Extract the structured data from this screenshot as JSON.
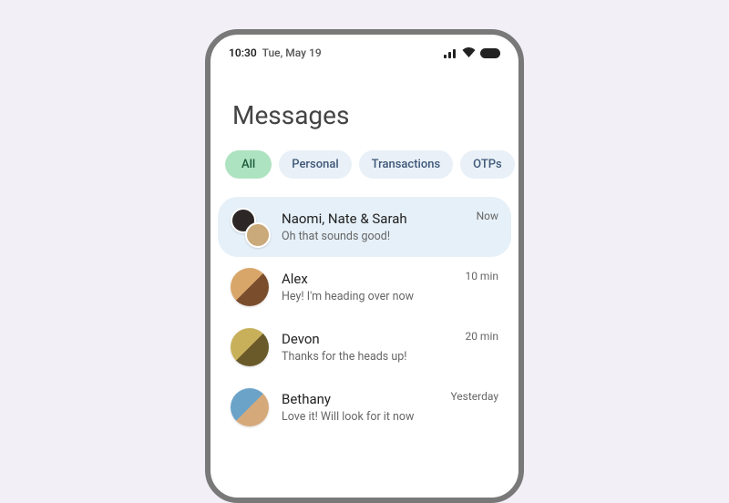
{
  "status": {
    "time": "10:30",
    "date": "Tue, May 19"
  },
  "page": {
    "title": "Messages"
  },
  "tabs": [
    {
      "label": "All",
      "active": true
    },
    {
      "label": "Personal",
      "active": false
    },
    {
      "label": "Transactions",
      "active": false
    },
    {
      "label": "OTPs",
      "active": false
    }
  ],
  "conversations": [
    {
      "name": "Naomi, Nate & Sarah",
      "preview": "Oh that sounds good!",
      "time": "Now",
      "highlight": true,
      "group": true
    },
    {
      "name": "Alex",
      "preview": "Hey! I'm heading over now",
      "time": "10 min",
      "highlight": false,
      "group": false
    },
    {
      "name": "Devon",
      "preview": "Thanks for the heads up!",
      "time": "20 min",
      "highlight": false,
      "group": false
    },
    {
      "name": "Bethany",
      "preview": "Love it! Will look for it now",
      "time": "Yesterday",
      "highlight": false,
      "group": false
    }
  ],
  "avatar_colors": [
    [
      "#2c2626",
      "#caa97a"
    ],
    [
      "#d9a66a",
      "#7a4d2d"
    ],
    [
      "#c8b05a",
      "#6a5a2a"
    ],
    [
      "#6ba3c8",
      "#d6a97b"
    ]
  ]
}
